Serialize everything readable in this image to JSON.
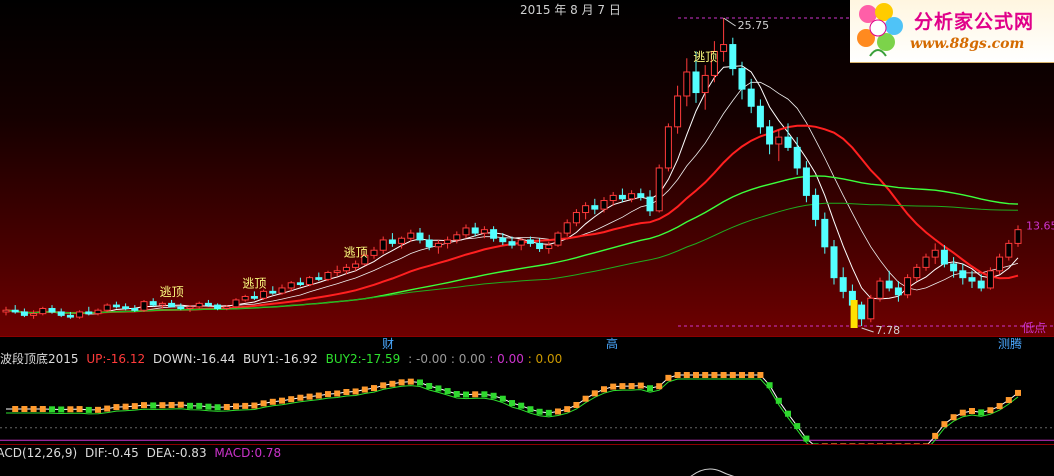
{
  "header": {
    "date": "2015 年 8 月 7 日"
  },
  "logo": {
    "title": "分析家公式网",
    "url": "www.88gs.com"
  },
  "main_chart": {
    "high_label": "25.75",
    "low_label": "7.78",
    "right_price": "13.65",
    "low_point_label": "低点",
    "signal_label": "逃顶",
    "signals": [
      "逃顶",
      "逃顶",
      "逃顶",
      "逃顶"
    ],
    "markers": [
      "财",
      "高",
      "测腾"
    ]
  },
  "indicator1": {
    "name": "波段顶底2015",
    "up_label": "UP:",
    "up_value": "-16.12",
    "down_label": "DOWN:",
    "down_value": "-16.44",
    "buy1_label": "BUY1:",
    "buy1_value": "-16.92",
    "buy2_label": "BUY2:",
    "buy2_value": "-17.59",
    "v1": ": -0.00",
    "v2": ": 0.00",
    "v3": ": 0.00",
    "v4": ": 0.00"
  },
  "indicator2": {
    "name": "MACD(12,26,9)",
    "dif_label": "DIF:",
    "dif_value": "-0.45",
    "dea_label": "DEA:",
    "dea_value": "-0.83",
    "macd_label": "MACD:",
    "macd_value": "0.78"
  },
  "colors": {
    "up": "#ff3b3b",
    "down": "#54ffff",
    "ma1": "#ffffff",
    "ma2": "#ff2020",
    "ma3": "#2ee02e",
    "ma4": "#3cff3c",
    "marker": "#4aa8ff",
    "cursor": "#cc33cc",
    "signal": "#ffff80",
    "hist_up": "#ff9a2e",
    "hist_down": "#2ed82e"
  },
  "chart_data": {
    "type": "candlestick",
    "title": "",
    "price_range": [
      7.78,
      25.75
    ],
    "candles": [
      [
        8.6,
        8.9,
        8.4,
        8.7
      ],
      [
        8.7,
        9.0,
        8.5,
        8.6
      ],
      [
        8.6,
        8.8,
        8.3,
        8.4
      ],
      [
        8.4,
        8.7,
        8.2,
        8.5
      ],
      [
        8.5,
        8.9,
        8.4,
        8.8
      ],
      [
        8.8,
        9.0,
        8.5,
        8.6
      ],
      [
        8.6,
        8.8,
        8.3,
        8.4
      ],
      [
        8.4,
        8.6,
        8.2,
        8.3
      ],
      [
        8.3,
        8.7,
        8.2,
        8.6
      ],
      [
        8.6,
        8.9,
        8.4,
        8.5
      ],
      [
        8.5,
        8.8,
        8.4,
        8.7
      ],
      [
        8.7,
        9.1,
        8.6,
        9.0
      ],
      [
        9.0,
        9.2,
        8.8,
        8.9
      ],
      [
        8.9,
        9.1,
        8.7,
        8.8
      ],
      [
        8.8,
        9.0,
        8.6,
        8.7
      ],
      [
        8.7,
        9.3,
        8.6,
        9.2
      ],
      [
        9.2,
        9.4,
        8.9,
        9.0
      ],
      [
        9.0,
        9.2,
        8.8,
        9.1
      ],
      [
        9.1,
        9.3,
        8.9,
        8.9
      ],
      [
        8.9,
        9.1,
        8.7,
        8.8
      ],
      [
        8.8,
        9.0,
        8.6,
        8.9
      ],
      [
        8.9,
        9.2,
        8.8,
        9.1
      ],
      [
        9.1,
        9.3,
        8.9,
        9.0
      ],
      [
        9.0,
        9.1,
        8.7,
        8.8
      ],
      [
        8.8,
        9.0,
        8.7,
        8.9
      ],
      [
        8.9,
        9.4,
        8.8,
        9.3
      ],
      [
        9.3,
        9.6,
        9.2,
        9.5
      ],
      [
        9.5,
        9.8,
        9.3,
        9.4
      ],
      [
        9.4,
        9.9,
        9.3,
        9.8
      ],
      [
        9.8,
        10.1,
        9.6,
        9.7
      ],
      [
        9.7,
        10.2,
        9.6,
        10.0
      ],
      [
        10.0,
        10.4,
        9.8,
        10.3
      ],
      [
        10.3,
        10.6,
        10.1,
        10.2
      ],
      [
        10.2,
        10.7,
        10.1,
        10.6
      ],
      [
        10.6,
        10.9,
        10.4,
        10.5
      ],
      [
        10.5,
        11.0,
        10.4,
        10.9
      ],
      [
        10.9,
        11.3,
        10.7,
        11.0
      ],
      [
        11.0,
        11.4,
        10.8,
        11.2
      ],
      [
        11.2,
        11.6,
        11.0,
        11.4
      ],
      [
        11.4,
        12.0,
        11.3,
        11.9
      ],
      [
        11.9,
        12.4,
        11.7,
        12.2
      ],
      [
        12.2,
        13.0,
        12.0,
        12.8
      ],
      [
        12.8,
        13.2,
        12.4,
        12.6
      ],
      [
        12.6,
        13.0,
        12.3,
        12.9
      ],
      [
        12.9,
        13.4,
        12.7,
        13.2
      ],
      [
        13.2,
        13.5,
        12.6,
        12.8
      ],
      [
        12.8,
        13.1,
        12.2,
        12.4
      ],
      [
        12.4,
        12.8,
        12.0,
        12.6
      ],
      [
        12.6,
        13.0,
        12.3,
        12.8
      ],
      [
        12.8,
        13.3,
        12.6,
        13.1
      ],
      [
        13.1,
        13.7,
        12.9,
        13.5
      ],
      [
        13.5,
        13.8,
        13.0,
        13.2
      ],
      [
        13.2,
        13.6,
        12.9,
        13.4
      ],
      [
        13.4,
        13.6,
        12.7,
        12.9
      ],
      [
        12.9,
        13.2,
        12.5,
        12.7
      ],
      [
        12.7,
        13.0,
        12.3,
        12.5
      ],
      [
        12.5,
        12.9,
        12.2,
        12.8
      ],
      [
        12.8,
        13.0,
        12.4,
        12.6
      ],
      [
        12.6,
        12.9,
        12.1,
        12.3
      ],
      [
        12.3,
        12.7,
        12.0,
        12.5
      ],
      [
        12.5,
        13.3,
        12.4,
        13.2
      ],
      [
        13.2,
        14.0,
        13.0,
        13.8
      ],
      [
        13.8,
        14.6,
        13.6,
        14.4
      ],
      [
        14.4,
        15.0,
        14.0,
        14.8
      ],
      [
        14.8,
        15.2,
        14.3,
        14.6
      ],
      [
        14.6,
        15.3,
        14.4,
        15.1
      ],
      [
        15.1,
        15.6,
        14.8,
        15.4
      ],
      [
        15.4,
        15.8,
        15.0,
        15.2
      ],
      [
        15.2,
        15.7,
        15.0,
        15.5
      ],
      [
        15.5,
        15.8,
        15.1,
        15.3
      ],
      [
        15.3,
        15.7,
        14.2,
        14.5
      ],
      [
        14.5,
        17.2,
        14.4,
        17.0
      ],
      [
        17.0,
        19.6,
        16.8,
        19.4
      ],
      [
        19.4,
        21.8,
        19.0,
        21.2
      ],
      [
        21.2,
        23.4,
        20.6,
        22.6
      ],
      [
        22.6,
        23.8,
        20.8,
        21.4
      ],
      [
        21.4,
        23.0,
        20.4,
        22.4
      ],
      [
        22.4,
        24.4,
        22.0,
        23.8
      ],
      [
        23.8,
        25.75,
        23.2,
        24.2
      ],
      [
        24.2,
        24.6,
        22.4,
        22.8
      ],
      [
        22.8,
        23.2,
        21.0,
        21.6
      ],
      [
        21.6,
        22.2,
        20.2,
        20.6
      ],
      [
        20.6,
        21.0,
        19.0,
        19.4
      ],
      [
        19.4,
        19.8,
        17.8,
        18.4
      ],
      [
        18.4,
        19.2,
        17.4,
        18.8
      ],
      [
        18.8,
        19.6,
        18.0,
        18.2
      ],
      [
        18.2,
        18.8,
        16.6,
        17.0
      ],
      [
        17.0,
        17.4,
        15.0,
        15.4
      ],
      [
        15.4,
        15.8,
        13.6,
        14.0
      ],
      [
        14.0,
        14.4,
        12.0,
        12.4
      ],
      [
        12.4,
        12.8,
        10.2,
        10.6
      ],
      [
        10.6,
        11.2,
        9.4,
        9.8
      ],
      [
        9.8,
        10.2,
        8.6,
        9.0
      ],
      [
        9.0,
        9.2,
        7.78,
        8.2
      ],
      [
        8.2,
        9.6,
        8.0,
        9.4
      ],
      [
        9.4,
        10.6,
        9.2,
        10.4
      ],
      [
        10.4,
        11.0,
        9.8,
        10.0
      ],
      [
        10.0,
        10.4,
        9.2,
        9.6
      ],
      [
        9.6,
        10.8,
        9.4,
        10.6
      ],
      [
        10.6,
        11.4,
        10.4,
        11.2
      ],
      [
        11.2,
        12.0,
        11.0,
        11.8
      ],
      [
        11.8,
        12.6,
        11.4,
        12.2
      ],
      [
        12.2,
        12.5,
        11.2,
        11.4
      ],
      [
        11.4,
        11.8,
        10.6,
        11.0
      ],
      [
        11.0,
        11.4,
        10.2,
        10.6
      ],
      [
        10.6,
        11.0,
        10.0,
        10.4
      ],
      [
        10.4,
        10.8,
        9.8,
        10.0
      ],
      [
        10.0,
        11.2,
        9.9,
        11.0
      ],
      [
        11.0,
        12.0,
        10.8,
        11.8
      ],
      [
        11.8,
        12.8,
        11.6,
        12.6
      ],
      [
        12.6,
        13.65,
        12.4,
        13.4
      ]
    ],
    "price_labels": {
      "high": 25.75,
      "low": 7.78,
      "last": 13.65
    }
  }
}
